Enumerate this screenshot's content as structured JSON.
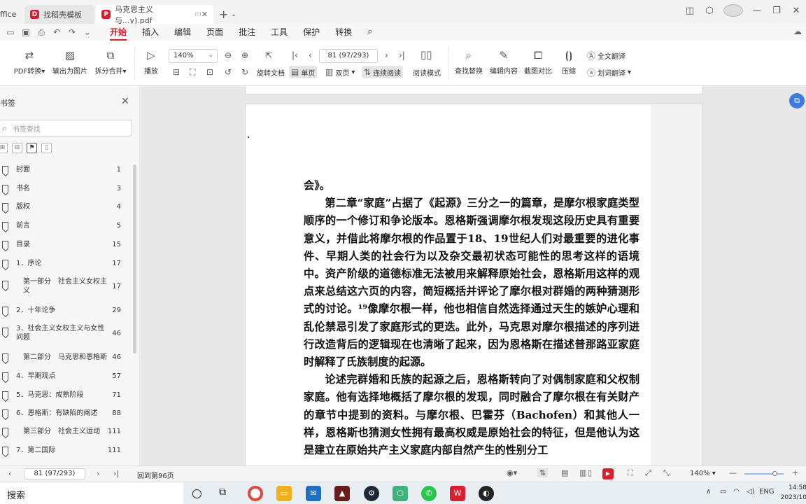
{
  "tabs": [
    {
      "label": "ffice"
    },
    {
      "label": "找稻壳模板"
    },
    {
      "label": "马克思主义与...y).pdf"
    }
  ],
  "menu": [
    "开始",
    "插入",
    "编辑",
    "页面",
    "批注",
    "工具",
    "保护",
    "转换"
  ],
  "ribbon": {
    "pdf_convert": "PDF转换",
    "export_image": "输出为图片",
    "split_merge": "拆分合并",
    "play": "播放",
    "zoom": "140%",
    "page_input": "81 (97/293)",
    "rotate": "旋转文档",
    "single": "单页",
    "double": "双页",
    "continuous": "连续阅读",
    "reading_mode": "阅读模式",
    "find_replace": "查找替换",
    "edit_content": "编辑内容",
    "screenshot_compare": "截图对比",
    "compress": "压缩",
    "full_translate": "全文翻译",
    "word_translate": "划词翻译"
  },
  "sidebar": {
    "title": "书签",
    "search_placeholder": "书签查找",
    "bookmarks": [
      {
        "label": "封面",
        "page": "1"
      },
      {
        "label": "书名",
        "page": "3"
      },
      {
        "label": "版权",
        "page": "4"
      },
      {
        "label": "前言",
        "page": "5"
      },
      {
        "label": "目录",
        "page": "15"
      },
      {
        "label": "1．序论",
        "page": "17"
      },
      {
        "label": "第一部分　社会主义女权主义",
        "page": "17"
      },
      {
        "label": "2．十年论争",
        "page": "29"
      },
      {
        "label": "3．社会主义女权主义与女性问题",
        "page": "46"
      },
      {
        "label": "第二部分　马克思和恩格斯",
        "page": "46"
      },
      {
        "label": "4．早期观点",
        "page": "57"
      },
      {
        "label": "5．马克思：成熟阶段",
        "page": "71"
      },
      {
        "label": "6．恩格斯：有缺陷的阐述",
        "page": "88"
      },
      {
        "label": "第三部分　社会主义运动",
        "page": "111"
      },
      {
        "label": "7．第二国际",
        "page": "111"
      }
    ]
  },
  "document": {
    "paragraphs": [
      "会》。",
      "第二章“家庭”占据了《起源》三分之一的篇章，是摩尔根家庭类型顺序的一个修订和争论版本。恩格斯强调摩尔根发现这段历史具有重要意义，并借此将摩尔根的作品置于18、19世纪人们对最重要的进化事件、早期人类的社会行为以及杂交最初状态可能性的思考这样的语境中。资产阶级的道德标准无法被用来解释原始社会，恩格斯用这样的观点来总结这六页的内容，简短概括并评论了摩尔根对群婚的两种猜测形式的讨论。¹⁹像摩尔根一样，他也相信自然选择通过天生的嫉妒心理和乱伦禁忌引发了家庭形式的更迭。此外，马克思对摩尔根描述的序列进行改造背后的逻辑现在也清晰了起来，因为恩格斯在描述普那路亚家庭时解释了氏族制度的起源。",
      "论述完群婚和氏族的起源之后，恩格斯转向了对偶制家庭和父权制家庭。他有选择地概括了摩尔根的发现，同时融合了摩尔根在有关财产的章节中提到的资料。与摩尔根、巴霍芬（Bachofen）和其他人一样，恩格斯也猜测女性拥有最高权威是原始社会的特征，但是他认为这是建立在原始共产主义家庭内部自然产生的性别分工"
    ]
  },
  "status": {
    "page": "81 (97/293)",
    "info": "回到第96页",
    "zoom": "140%"
  },
  "taskbar": {
    "search": "搜索",
    "lang": "ENG",
    "time": "14:58",
    "date": "2023/10"
  }
}
